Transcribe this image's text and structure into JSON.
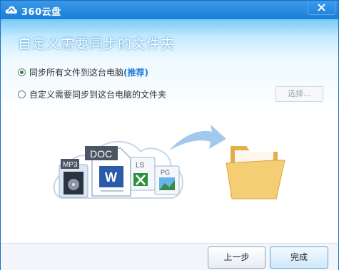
{
  "window": {
    "app_title": "360云盘",
    "page_title": "自定义需要同步的文件夹"
  },
  "options": {
    "sync_all_label": "同步所有文件到这台电脑",
    "sync_all_badge": "(推荐)",
    "custom_label": "自定义需要同步到这台电脑的文件夹",
    "choose_button": "选择...",
    "selected": "sync_all"
  },
  "illustration": {
    "doc_tag": "DOC",
    "mp3_tag": "MP3",
    "xls_tag": "LS",
    "jpg_tag": "PG"
  },
  "footer": {
    "prev_label": "上一步",
    "finish_label": "完成"
  },
  "colors": {
    "titlebar": "#1b7fd6",
    "accent": "#1f78d0",
    "folder": "#f2c568"
  }
}
